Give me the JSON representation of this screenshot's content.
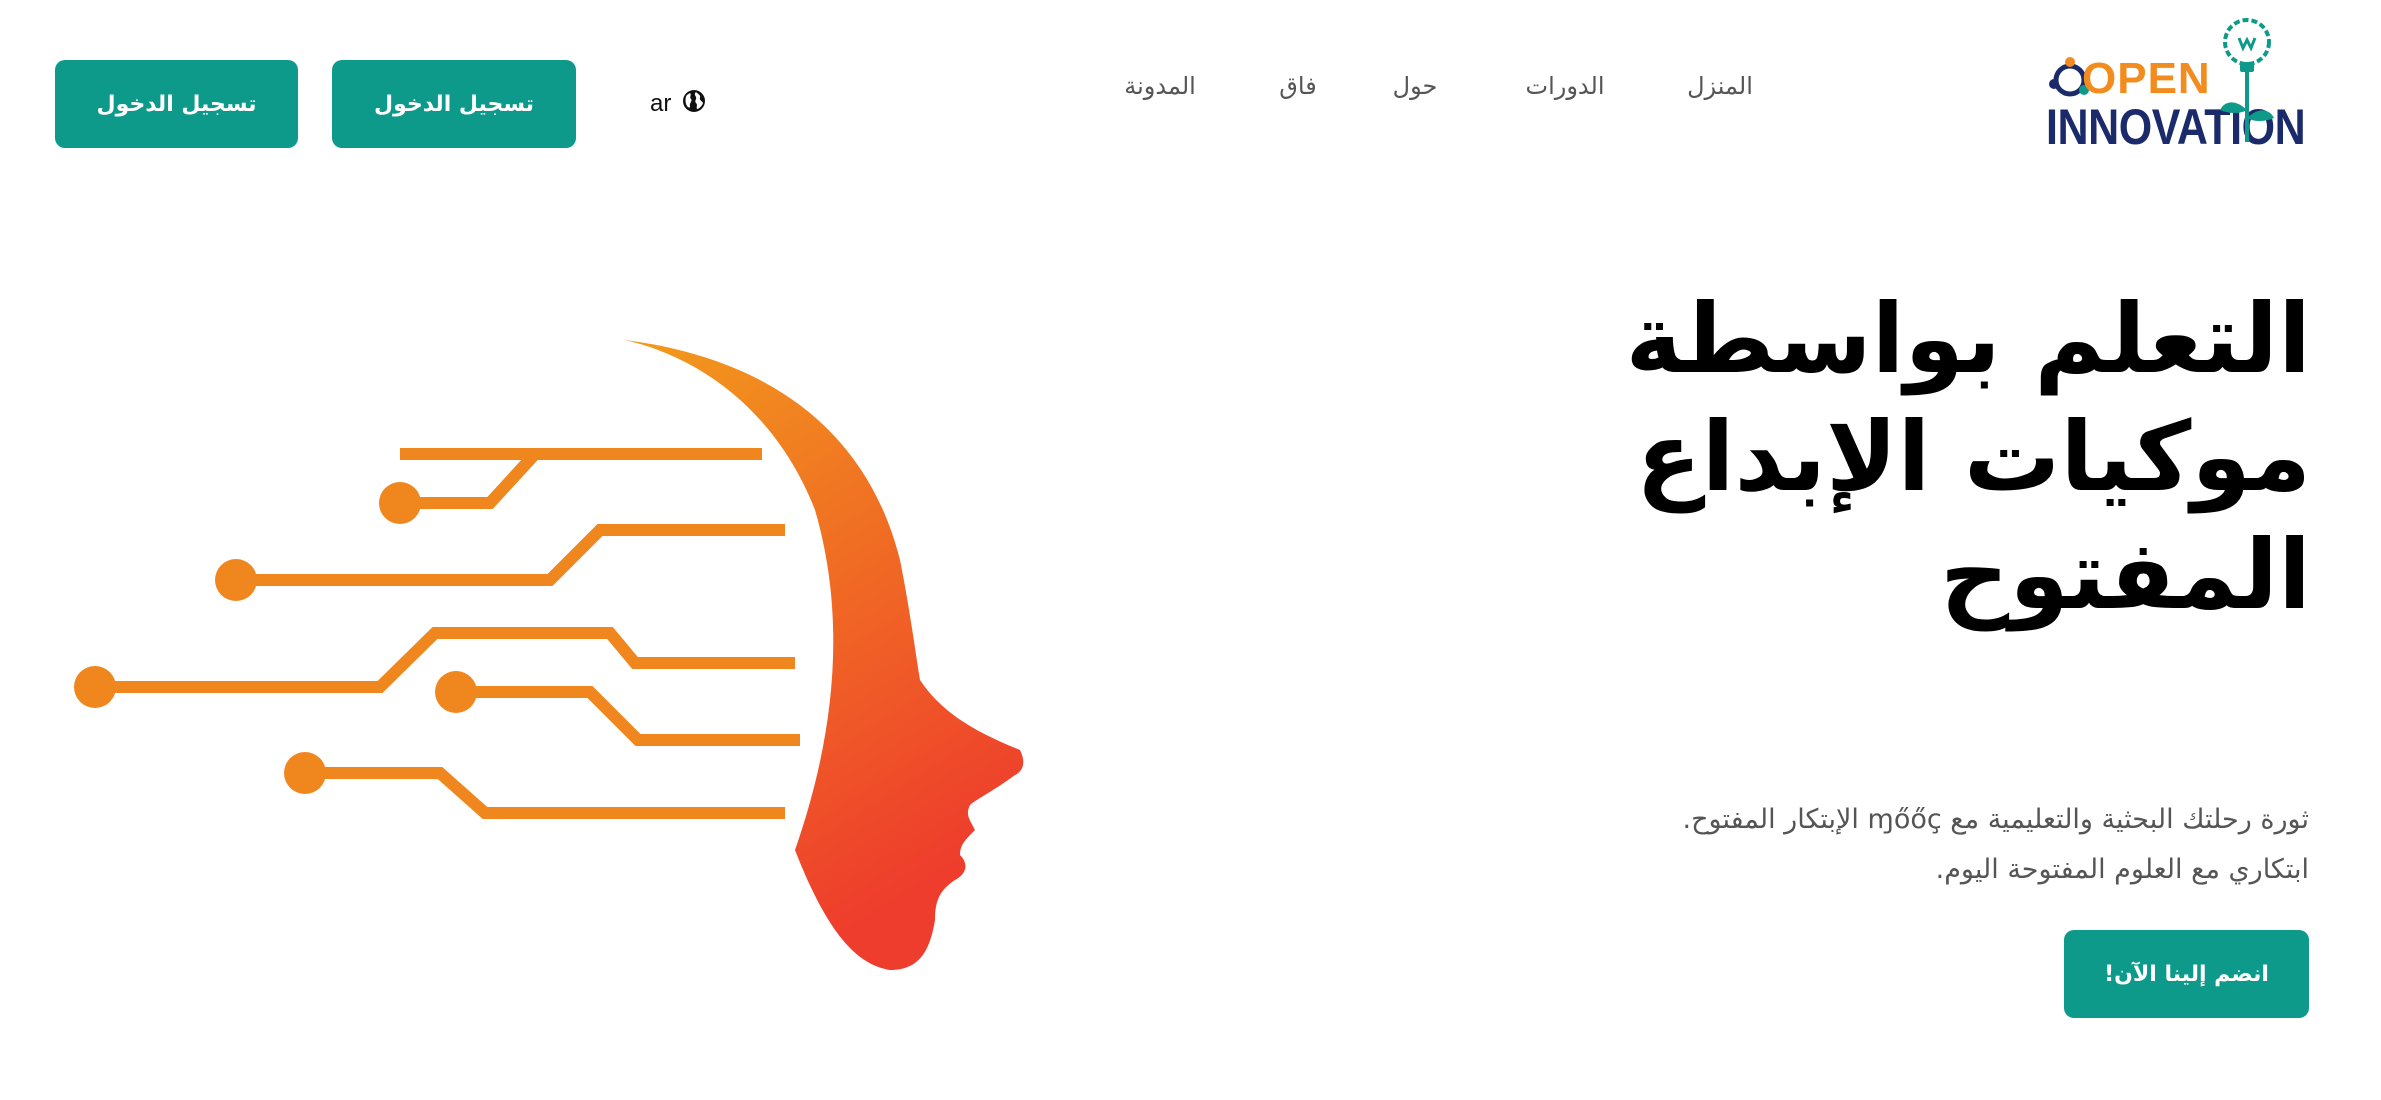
{
  "header": {
    "logo": {
      "line1": "OPEN",
      "line2": "INNOVATION"
    },
    "nav": {
      "home": "المنزل",
      "courses": "الدورات",
      "about": "حول",
      "faq": "فاق",
      "blog": "المدونة"
    },
    "language": {
      "label": "ar",
      "icon": "globe-icon"
    },
    "login_button_1": "تسجيل الدخول",
    "login_button_2": "تسجيل الدخول"
  },
  "hero": {
    "title": "التعلم بواسطة موكيات الإبداع المفتوح",
    "subtitle": "ثورة رحلتك البحثية والتعليمية مع ɱőőç الإبتكار المفتوح. ابتكاري مع العلوم المفتوحة اليوم.",
    "cta_label": "انضم إلينا الآن!",
    "illustration": "circuit-head-illustration"
  },
  "colors": {
    "accent": "#0e9a8a",
    "logo_orange": "#f28c1e",
    "logo_navy": "#1b2a6b",
    "illustration_orange": "#f0871e",
    "illustration_red": "#ee3d2c"
  }
}
